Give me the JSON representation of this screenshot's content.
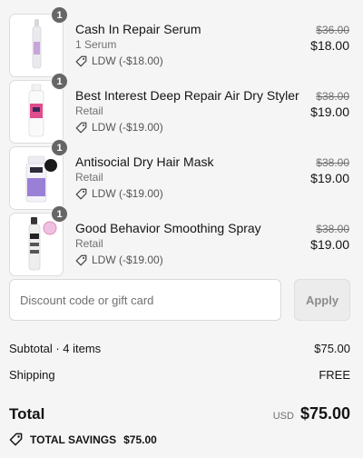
{
  "items": [
    {
      "quantity": "1",
      "title": "Cash In Repair Serum",
      "variant": "1 Serum",
      "discount": "LDW (-$18.00)",
      "original_price": "$36.00",
      "price": "$18.00",
      "product_color": "#c9a3d9"
    },
    {
      "quantity": "1",
      "title": "Best Interest Deep Repair Air Dry Styler",
      "variant": "Retail",
      "discount": "LDW (-$19.00)",
      "original_price": "$38.00",
      "price": "$19.00",
      "product_color": "#e04d8c"
    },
    {
      "quantity": "1",
      "title": "Antisocial Dry Hair Mask",
      "variant": "Retail",
      "discount": "LDW (-$19.00)",
      "original_price": "$38.00",
      "price": "$19.00",
      "product_color": "#9a7fd6"
    },
    {
      "quantity": "1",
      "title": "Good Behavior Smoothing Spray",
      "variant": "Retail",
      "discount": "LDW (-$19.00)",
      "original_price": "$38.00",
      "price": "$19.00",
      "product_color": "#f0c0e0"
    }
  ],
  "discount": {
    "placeholder": "Discount code or gift card",
    "apply_label": "Apply"
  },
  "summary": {
    "subtotal_label": "Subtotal · 4 items",
    "subtotal_value": "$75.00",
    "shipping_label": "Shipping",
    "shipping_value": "FREE",
    "total_label": "Total",
    "currency": "USD",
    "total_value": "$75.00",
    "savings_label": "TOTAL SAVINGS",
    "savings_value": "$75.00"
  },
  "icons": {
    "discount_tag": "tag-icon",
    "savings_tag": "tag-icon"
  }
}
